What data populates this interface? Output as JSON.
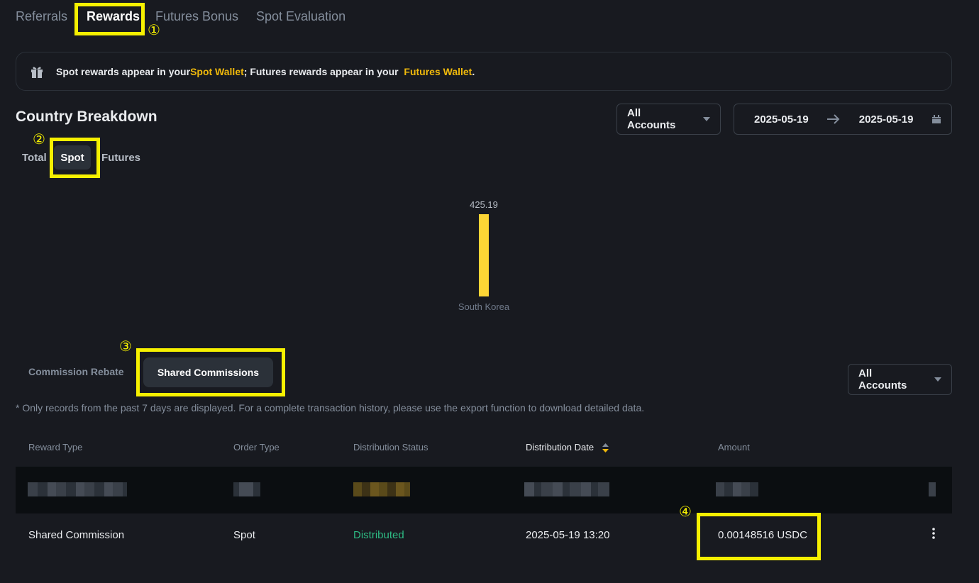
{
  "tabs": [
    "Referrals",
    "Rewards",
    "Futures Bonus",
    "Spot Evaluation"
  ],
  "markers": [
    "①",
    "②",
    "③",
    "④"
  ],
  "notice": {
    "part1": "Spot rewards appear in your ",
    "spot_wallet": "Spot Wallet",
    "part2": "; Futures rewards appear in your  ",
    "futures_wallet": "Futures Wallet",
    "part3": "."
  },
  "breakdown": {
    "title": "Country Breakdown",
    "accounts_select": "All Accounts",
    "date_from": "2025-05-19",
    "date_to": "2025-05-19",
    "subtabs": [
      "Total",
      "Spot",
      "Futures"
    ]
  },
  "chart_data": {
    "type": "bar",
    "categories": [
      "South Korea"
    ],
    "values": [
      425.19
    ],
    "data_labels": [
      "425.19"
    ],
    "bar_color": "#fcd535"
  },
  "commission": {
    "tabs": [
      "Commission Rebate",
      "Shared Commissions"
    ],
    "accounts_select": "All Accounts",
    "note": "* Only records from the past 7 days are displayed. For a complete transaction history, please use the export function to download detailed data."
  },
  "table": {
    "headers": [
      "Reward Type",
      "Order Type",
      "Distribution Status",
      "Distribution Date",
      "Amount"
    ],
    "row": {
      "reward_type": "Shared Commission",
      "order_type": "Spot",
      "status": "Distributed",
      "date": "2025-05-19 13:20",
      "amount": "0.00148516 USDC"
    }
  },
  "colors": {
    "accent": "#f0b90b",
    "highlight": "#f6f000",
    "success": "#2ebd85",
    "background": "#181a20"
  }
}
